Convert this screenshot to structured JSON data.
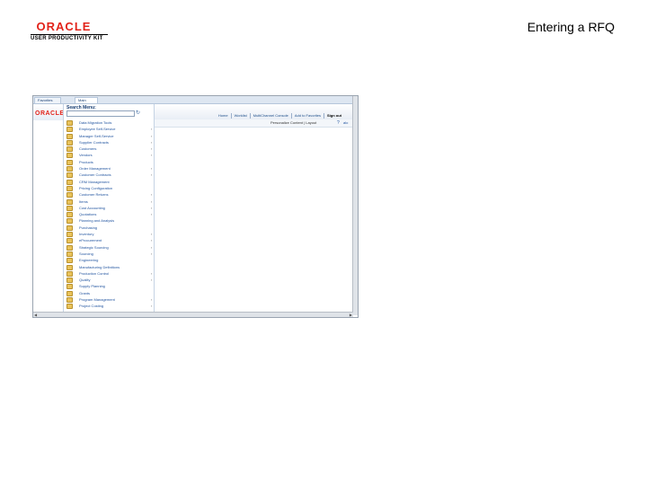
{
  "slide": {
    "title": "Entering a RFQ"
  },
  "brand": {
    "company": "ORACLE",
    "product": "USER PRODUCTIVITY KIT"
  },
  "app": {
    "tabs": [
      "Favorites",
      "Main Menu"
    ],
    "banner_logo": "ORACLE",
    "nav": [
      "Home",
      "Worklist",
      "MultiChannel Console",
      "Add to Favorites",
      "Sign out"
    ],
    "menu_title": "Search Menu:",
    "personalize": "Personalize Content | Layout",
    "help_icon": "?",
    "content_link": "alo",
    "menu_items": [
      {
        "label": "Data Migration Tools",
        "arrow": ""
      },
      {
        "label": "Employee Self-Service",
        "arrow": "›"
      },
      {
        "label": "Manager Self-Service",
        "arrow": "›"
      },
      {
        "label": "Supplier Contracts",
        "arrow": "›"
      },
      {
        "label": "Customers",
        "arrow": "›"
      },
      {
        "label": "Vendors",
        "arrow": "›"
      },
      {
        "label": "Products",
        "arrow": ""
      },
      {
        "label": "Order Management",
        "arrow": "›"
      },
      {
        "label": "Customer Contracts",
        "arrow": "›"
      },
      {
        "label": "CRM Management",
        "arrow": ""
      },
      {
        "label": "Pricing Configuration",
        "arrow": ""
      },
      {
        "label": "Customer Returns",
        "arrow": "›"
      },
      {
        "label": "Items",
        "arrow": "›"
      },
      {
        "label": "Cost Accounting",
        "arrow": "›"
      },
      {
        "label": "Quotations",
        "arrow": "›"
      },
      {
        "label": "Planning and Analysis",
        "arrow": ""
      },
      {
        "label": "Purchasing",
        "arrow": ""
      },
      {
        "label": "Inventory",
        "arrow": "›"
      },
      {
        "label": "eProcurement",
        "arrow": "›"
      },
      {
        "label": "Strategic Sourcing",
        "arrow": "›"
      },
      {
        "label": "Sourcing",
        "arrow": "›"
      },
      {
        "label": "Engineering",
        "arrow": ""
      },
      {
        "label": "Manufacturing Definitions",
        "arrow": ""
      },
      {
        "label": "Production Control",
        "arrow": "›"
      },
      {
        "label": "Quality",
        "arrow": "›"
      },
      {
        "label": "Supply Planning",
        "arrow": ""
      },
      {
        "label": "Grants",
        "arrow": ""
      },
      {
        "label": "Program Management",
        "arrow": "›"
      },
      {
        "label": "Project Costing",
        "arrow": "›"
      }
    ]
  }
}
